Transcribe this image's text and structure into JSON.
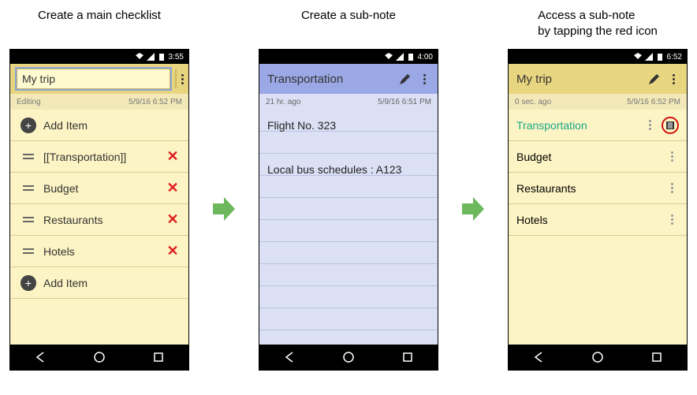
{
  "captions": {
    "screen1": "Create a main checklist",
    "screen2": "Create a sub-note",
    "screen3": "Access a sub-note\nby tapping the red icon"
  },
  "screen1": {
    "status_time": "3:55",
    "title": "My trip",
    "meta_left": "Editing",
    "meta_right": "5/9/16 6:52 PM",
    "rows": {
      "additem1": "Add Item",
      "item1": "[[Transportation]]",
      "item2": "Budget",
      "item3": "Restaurants",
      "item4": "Hotels",
      "additem2": "Add Item"
    }
  },
  "screen2": {
    "status_time": "4:00",
    "title": "Transportation",
    "meta_left": "21 hr. ago",
    "meta_right": "5/9/16 6:51 PM",
    "line1": "Flight No. 323",
    "line2": "Local bus schedules : A123"
  },
  "screen3": {
    "status_time": "6:52",
    "title": "My trip",
    "meta_left": "0 sec. ago",
    "meta_right": "5/9/16 6:52 PM",
    "rows": {
      "item1": "Transportation",
      "item2": "Budget",
      "item3": "Restaurants",
      "item4": "Hotels"
    }
  }
}
